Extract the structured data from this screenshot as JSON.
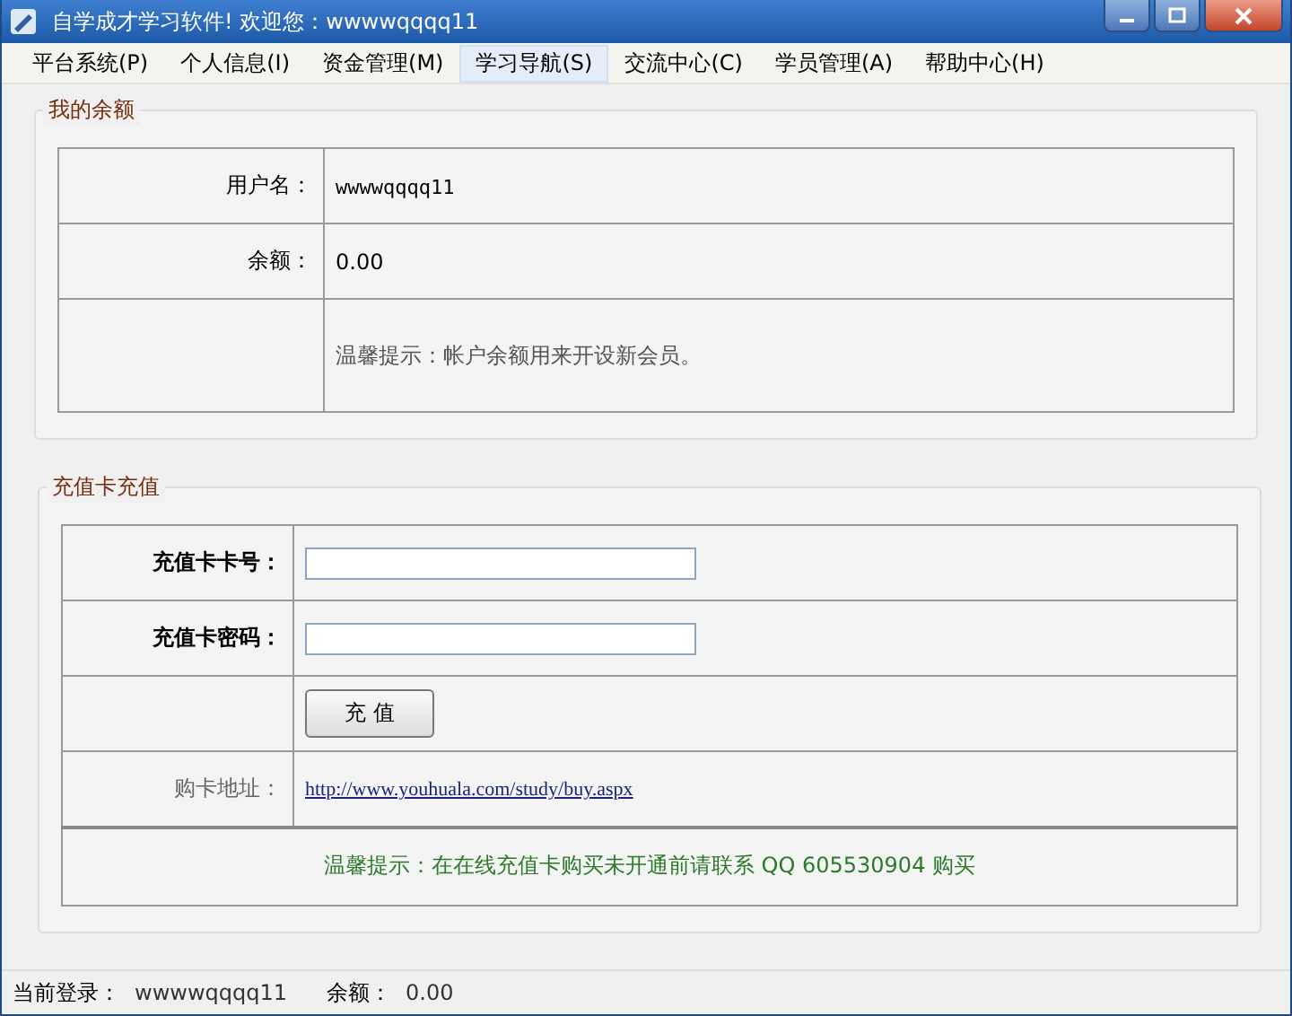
{
  "window": {
    "title": "自学成才学习软件! 欢迎您：wwwwqqqq11"
  },
  "menu": [
    {
      "label": "平台系统(P)",
      "selected": false
    },
    {
      "label": "个人信息(I)",
      "selected": false
    },
    {
      "label": "资金管理(M)",
      "selected": false
    },
    {
      "label": "学习导航(S)",
      "selected": true
    },
    {
      "label": "交流中心(C)",
      "selected": false
    },
    {
      "label": "学员管理(A)",
      "selected": false
    },
    {
      "label": "帮助中心(H)",
      "selected": false
    }
  ],
  "balance_group": {
    "title": "我的余额",
    "rows": [
      {
        "label": "用户名：",
        "value": "wwwwqqqq11"
      },
      {
        "label": "余额：",
        "value": "0.00"
      },
      {
        "value": "温馨提示：帐户余额用来开设新会员。"
      }
    ]
  },
  "recharge_group": {
    "title": "充值卡充值",
    "rows": [
      {
        "kind": "input",
        "label": "充值卡卡号："
      },
      {
        "kind": "input",
        "label": "充值卡密码："
      },
      {
        "kind": "button",
        "button": "充 值"
      },
      {
        "kind": "link",
        "label": "购卡地址：",
        "link": "http://www.youhuala.com/study/buy.aspx"
      }
    ],
    "notice": "温馨提示：在在线充值卡购买未开通前请联系 QQ 605530904 购买"
  },
  "status_bar": {
    "login_label": "当前登录：",
    "login_value": "wwwwqqqq11",
    "balance_label": "余额：",
    "balance_value": "0.00"
  }
}
